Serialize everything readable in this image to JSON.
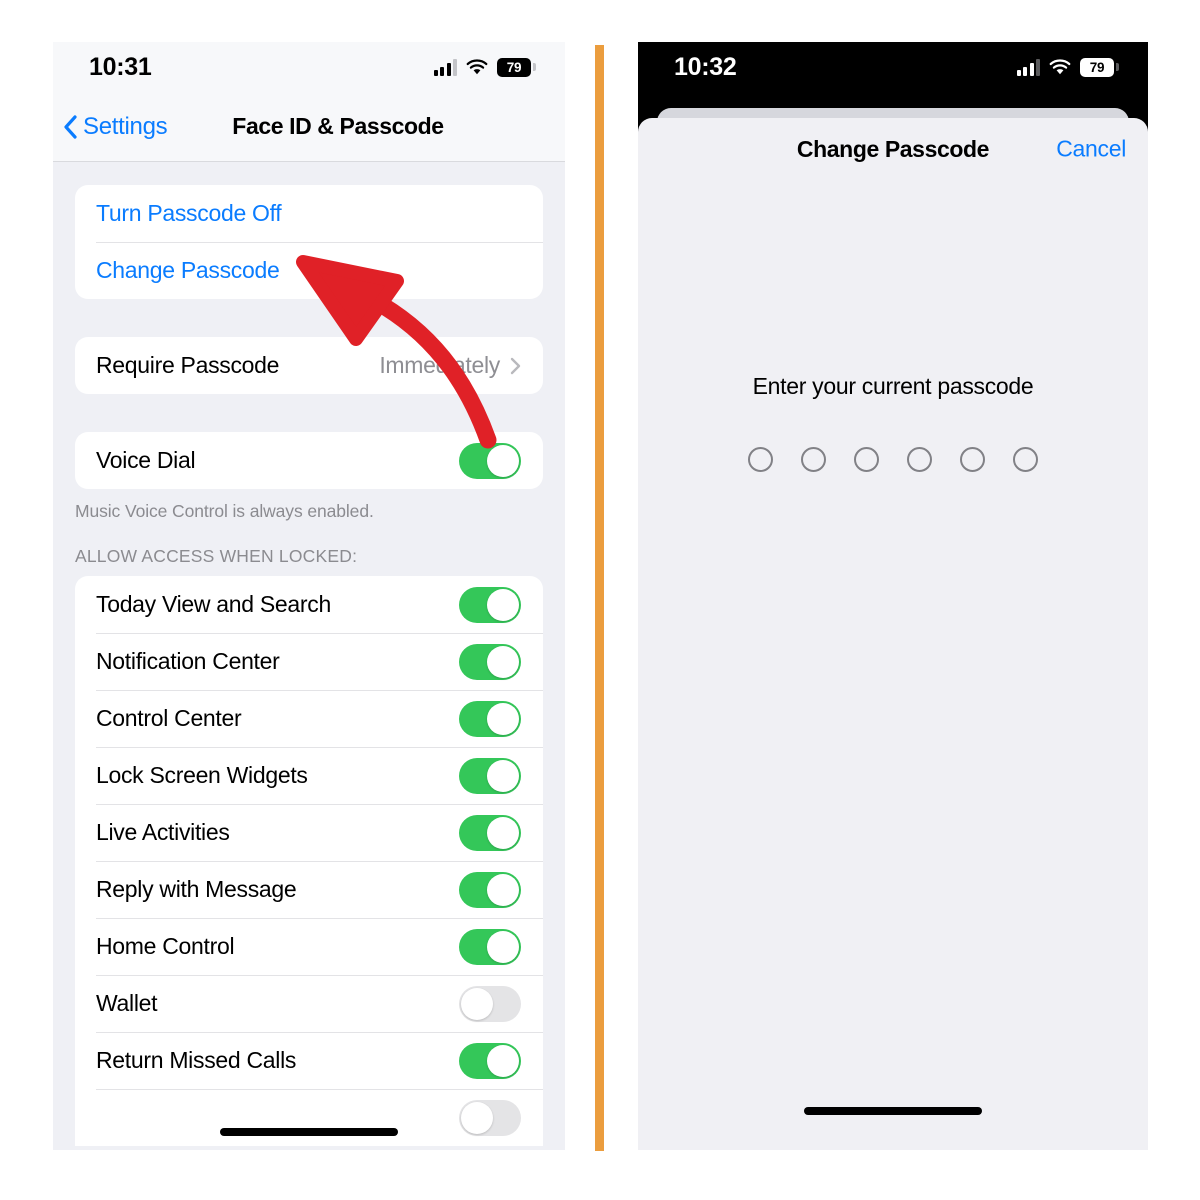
{
  "left_phone": {
    "status_bar": {
      "time": "10:31",
      "battery_percent": "79",
      "cellular_icon": "cellular-bars-icon",
      "wifi_icon": "wifi-icon",
      "battery_icon": "battery-icon"
    },
    "nav": {
      "back_label": "Settings",
      "back_icon": "chevron-left-icon",
      "title": "Face ID & Passcode"
    },
    "group_passcode": [
      {
        "label": "Turn Passcode Off",
        "type": "link"
      },
      {
        "label": "Change Passcode",
        "type": "link"
      }
    ],
    "group_require": [
      {
        "label": "Require Passcode",
        "value": "Immediately",
        "type": "disclosure",
        "icon": "chevron-right-icon"
      }
    ],
    "group_voice": [
      {
        "label": "Voice Dial",
        "type": "toggle",
        "on": true
      }
    ],
    "voice_footnote": "Music Voice Control is always enabled.",
    "allow_access_header": "ALLOW ACCESS WHEN LOCKED:",
    "group_allow_access": [
      {
        "label": "Today View and Search",
        "type": "toggle",
        "on": true
      },
      {
        "label": "Notification Center",
        "type": "toggle",
        "on": true
      },
      {
        "label": "Control Center",
        "type": "toggle",
        "on": true
      },
      {
        "label": "Lock Screen Widgets",
        "type": "toggle",
        "on": true
      },
      {
        "label": "Live Activities",
        "type": "toggle",
        "on": true
      },
      {
        "label": "Reply with Message",
        "type": "toggle",
        "on": true
      },
      {
        "label": "Home Control",
        "type": "toggle",
        "on": true
      },
      {
        "label": "Wallet",
        "type": "toggle",
        "on": false
      },
      {
        "label": "Return Missed Calls",
        "type": "toggle",
        "on": true
      },
      {
        "label": "",
        "type": "toggle",
        "on": false
      }
    ]
  },
  "right_phone": {
    "status_bar": {
      "time": "10:32",
      "battery_percent": "79",
      "cellular_icon": "cellular-bars-icon",
      "wifi_icon": "wifi-icon",
      "battery_icon": "battery-icon"
    },
    "sheet": {
      "title": "Change Passcode",
      "cancel_label": "Cancel",
      "prompt": "Enter your current passcode",
      "passcode_length": 6,
      "passcode_filled": 0
    }
  },
  "annotation": {
    "arrow_color": "#e02127",
    "arrow_target": "Change Passcode",
    "arrow_icon": "curved-arrow-icon"
  },
  "divider": {
    "color": "#eb9d3e"
  },
  "colors": {
    "ios_blue": "#0a7cff",
    "toggle_green": "#34c759",
    "toggle_off": "#e4e4e6",
    "group_bg": "#eff0f5",
    "secondary_text": "#8e8e93"
  }
}
